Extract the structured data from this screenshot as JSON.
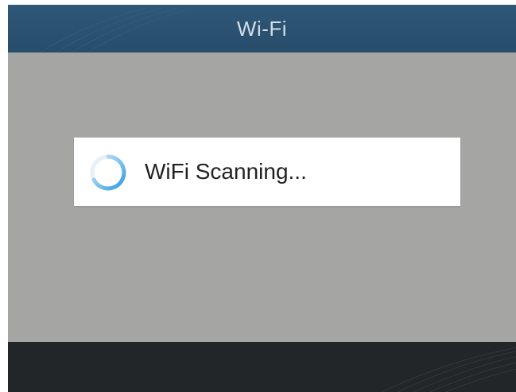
{
  "window": {
    "title": "Wi-Fi"
  },
  "dialog": {
    "message": "WiFi Scanning...",
    "spinner_icon": "loading-spinner-icon"
  },
  "colors": {
    "titlebar": "#2b5372",
    "content_background": "#a5a5a3",
    "dialog_background": "#ffffff",
    "spinner_accent": "#2e9be6",
    "bottombar": "#222628"
  }
}
